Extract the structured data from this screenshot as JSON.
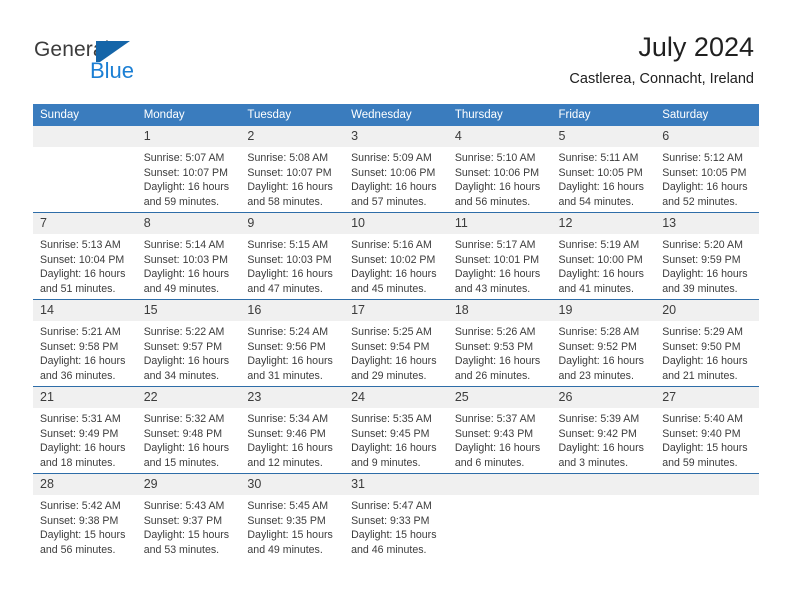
{
  "brand": {
    "name_part1": "General",
    "name_part2": "Blue",
    "logo_icon": "flag-triangle-icon",
    "accent_color": "#1b7fd4"
  },
  "header": {
    "month_title": "July 2024",
    "location": "Castlerea, Connacht, Ireland"
  },
  "theme": {
    "header_blue": "#3a7cbe",
    "separator_blue": "#2e6da8",
    "daynum_band": "#f0f0f0"
  },
  "calendar": {
    "weekday_headers": [
      "Sunday",
      "Monday",
      "Tuesday",
      "Wednesday",
      "Thursday",
      "Friday",
      "Saturday"
    ],
    "labels": {
      "sunrise": "Sunrise:",
      "sunset": "Sunset:",
      "daylight": "Daylight:"
    },
    "weeks": [
      [
        {
          "day": "",
          "sunrise": "",
          "sunset": "",
          "daylight_line1": "",
          "daylight_line2": ""
        },
        {
          "day": "1",
          "sunrise": "Sunrise: 5:07 AM",
          "sunset": "Sunset: 10:07 PM",
          "daylight_line1": "Daylight: 16 hours",
          "daylight_line2": "and 59 minutes."
        },
        {
          "day": "2",
          "sunrise": "Sunrise: 5:08 AM",
          "sunset": "Sunset: 10:07 PM",
          "daylight_line1": "Daylight: 16 hours",
          "daylight_line2": "and 58 minutes."
        },
        {
          "day": "3",
          "sunrise": "Sunrise: 5:09 AM",
          "sunset": "Sunset: 10:06 PM",
          "daylight_line1": "Daylight: 16 hours",
          "daylight_line2": "and 57 minutes."
        },
        {
          "day": "4",
          "sunrise": "Sunrise: 5:10 AM",
          "sunset": "Sunset: 10:06 PM",
          "daylight_line1": "Daylight: 16 hours",
          "daylight_line2": "and 56 minutes."
        },
        {
          "day": "5",
          "sunrise": "Sunrise: 5:11 AM",
          "sunset": "Sunset: 10:05 PM",
          "daylight_line1": "Daylight: 16 hours",
          "daylight_line2": "and 54 minutes."
        },
        {
          "day": "6",
          "sunrise": "Sunrise: 5:12 AM",
          "sunset": "Sunset: 10:05 PM",
          "daylight_line1": "Daylight: 16 hours",
          "daylight_line2": "and 52 minutes."
        }
      ],
      [
        {
          "day": "7",
          "sunrise": "Sunrise: 5:13 AM",
          "sunset": "Sunset: 10:04 PM",
          "daylight_line1": "Daylight: 16 hours",
          "daylight_line2": "and 51 minutes."
        },
        {
          "day": "8",
          "sunrise": "Sunrise: 5:14 AM",
          "sunset": "Sunset: 10:03 PM",
          "daylight_line1": "Daylight: 16 hours",
          "daylight_line2": "and 49 minutes."
        },
        {
          "day": "9",
          "sunrise": "Sunrise: 5:15 AM",
          "sunset": "Sunset: 10:03 PM",
          "daylight_line1": "Daylight: 16 hours",
          "daylight_line2": "and 47 minutes."
        },
        {
          "day": "10",
          "sunrise": "Sunrise: 5:16 AM",
          "sunset": "Sunset: 10:02 PM",
          "daylight_line1": "Daylight: 16 hours",
          "daylight_line2": "and 45 minutes."
        },
        {
          "day": "11",
          "sunrise": "Sunrise: 5:17 AM",
          "sunset": "Sunset: 10:01 PM",
          "daylight_line1": "Daylight: 16 hours",
          "daylight_line2": "and 43 minutes."
        },
        {
          "day": "12",
          "sunrise": "Sunrise: 5:19 AM",
          "sunset": "Sunset: 10:00 PM",
          "daylight_line1": "Daylight: 16 hours",
          "daylight_line2": "and 41 minutes."
        },
        {
          "day": "13",
          "sunrise": "Sunrise: 5:20 AM",
          "sunset": "Sunset: 9:59 PM",
          "daylight_line1": "Daylight: 16 hours",
          "daylight_line2": "and 39 minutes."
        }
      ],
      [
        {
          "day": "14",
          "sunrise": "Sunrise: 5:21 AM",
          "sunset": "Sunset: 9:58 PM",
          "daylight_line1": "Daylight: 16 hours",
          "daylight_line2": "and 36 minutes."
        },
        {
          "day": "15",
          "sunrise": "Sunrise: 5:22 AM",
          "sunset": "Sunset: 9:57 PM",
          "daylight_line1": "Daylight: 16 hours",
          "daylight_line2": "and 34 minutes."
        },
        {
          "day": "16",
          "sunrise": "Sunrise: 5:24 AM",
          "sunset": "Sunset: 9:56 PM",
          "daylight_line1": "Daylight: 16 hours",
          "daylight_line2": "and 31 minutes."
        },
        {
          "day": "17",
          "sunrise": "Sunrise: 5:25 AM",
          "sunset": "Sunset: 9:54 PM",
          "daylight_line1": "Daylight: 16 hours",
          "daylight_line2": "and 29 minutes."
        },
        {
          "day": "18",
          "sunrise": "Sunrise: 5:26 AM",
          "sunset": "Sunset: 9:53 PM",
          "daylight_line1": "Daylight: 16 hours",
          "daylight_line2": "and 26 minutes."
        },
        {
          "day": "19",
          "sunrise": "Sunrise: 5:28 AM",
          "sunset": "Sunset: 9:52 PM",
          "daylight_line1": "Daylight: 16 hours",
          "daylight_line2": "and 23 minutes."
        },
        {
          "day": "20",
          "sunrise": "Sunrise: 5:29 AM",
          "sunset": "Sunset: 9:50 PM",
          "daylight_line1": "Daylight: 16 hours",
          "daylight_line2": "and 21 minutes."
        }
      ],
      [
        {
          "day": "21",
          "sunrise": "Sunrise: 5:31 AM",
          "sunset": "Sunset: 9:49 PM",
          "daylight_line1": "Daylight: 16 hours",
          "daylight_line2": "and 18 minutes."
        },
        {
          "day": "22",
          "sunrise": "Sunrise: 5:32 AM",
          "sunset": "Sunset: 9:48 PM",
          "daylight_line1": "Daylight: 16 hours",
          "daylight_line2": "and 15 minutes."
        },
        {
          "day": "23",
          "sunrise": "Sunrise: 5:34 AM",
          "sunset": "Sunset: 9:46 PM",
          "daylight_line1": "Daylight: 16 hours",
          "daylight_line2": "and 12 minutes."
        },
        {
          "day": "24",
          "sunrise": "Sunrise: 5:35 AM",
          "sunset": "Sunset: 9:45 PM",
          "daylight_line1": "Daylight: 16 hours",
          "daylight_line2": "and 9 minutes."
        },
        {
          "day": "25",
          "sunrise": "Sunrise: 5:37 AM",
          "sunset": "Sunset: 9:43 PM",
          "daylight_line1": "Daylight: 16 hours",
          "daylight_line2": "and 6 minutes."
        },
        {
          "day": "26",
          "sunrise": "Sunrise: 5:39 AM",
          "sunset": "Sunset: 9:42 PM",
          "daylight_line1": "Daylight: 16 hours",
          "daylight_line2": "and 3 minutes."
        },
        {
          "day": "27",
          "sunrise": "Sunrise: 5:40 AM",
          "sunset": "Sunset: 9:40 PM",
          "daylight_line1": "Daylight: 15 hours",
          "daylight_line2": "and 59 minutes."
        }
      ],
      [
        {
          "day": "28",
          "sunrise": "Sunrise: 5:42 AM",
          "sunset": "Sunset: 9:38 PM",
          "daylight_line1": "Daylight: 15 hours",
          "daylight_line2": "and 56 minutes."
        },
        {
          "day": "29",
          "sunrise": "Sunrise: 5:43 AM",
          "sunset": "Sunset: 9:37 PM",
          "daylight_line1": "Daylight: 15 hours",
          "daylight_line2": "and 53 minutes."
        },
        {
          "day": "30",
          "sunrise": "Sunrise: 5:45 AM",
          "sunset": "Sunset: 9:35 PM",
          "daylight_line1": "Daylight: 15 hours",
          "daylight_line2": "and 49 minutes."
        },
        {
          "day": "31",
          "sunrise": "Sunrise: 5:47 AM",
          "sunset": "Sunset: 9:33 PM",
          "daylight_line1": "Daylight: 15 hours",
          "daylight_line2": "and 46 minutes."
        },
        {
          "day": "",
          "sunrise": "",
          "sunset": "",
          "daylight_line1": "",
          "daylight_line2": ""
        },
        {
          "day": "",
          "sunrise": "",
          "sunset": "",
          "daylight_line1": "",
          "daylight_line2": ""
        },
        {
          "day": "",
          "sunrise": "",
          "sunset": "",
          "daylight_line1": "",
          "daylight_line2": ""
        }
      ]
    ]
  }
}
